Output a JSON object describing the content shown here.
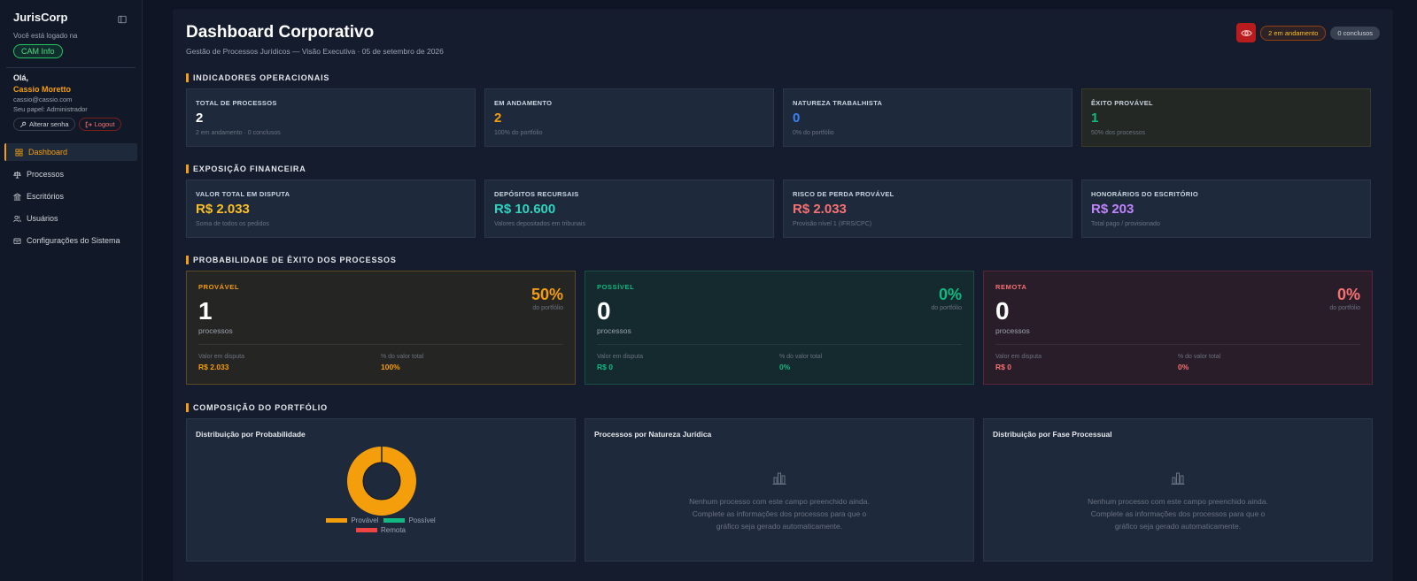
{
  "sidebar": {
    "brand": "JurisCorp",
    "logged_text": "Você está logado na",
    "company": "CAM Info",
    "greeting": "Olá,",
    "user_name": "Cassio Moretto",
    "user_email": "cassio@cassio.com",
    "user_role": "Seu papel: Administrador",
    "change_password": "Alterar senha",
    "logout": "Logout",
    "nav": [
      {
        "label": "Dashboard",
        "icon": "grid-icon",
        "active": true
      },
      {
        "label": "Processos",
        "icon": "scales-icon"
      },
      {
        "label": "Escritórios",
        "icon": "building-icon"
      },
      {
        "label": "Usuários",
        "icon": "users-icon"
      },
      {
        "label": "Configurações do Sistema",
        "icon": "gear-icon"
      }
    ]
  },
  "header": {
    "title": "Dashboard Corporativo",
    "subtitle": "Gestão de Processos Jurídicos — Visão Executiva · 05 de setembro de 2026",
    "pill_andamento": "2 em andamento",
    "pill_conclusos": "0 conclusos"
  },
  "indicadores": {
    "title": "INDICADORES OPERACIONAIS",
    "cards": [
      {
        "label": "TOTAL DE PROCESSOS",
        "value": "2",
        "sub": "2 em andamento · 0 conclusos"
      },
      {
        "label": "EM ANDAMENTO",
        "value": "2",
        "sub": "100% do portfólio"
      },
      {
        "label": "NATUREZA TRABALHISTA",
        "value": "0",
        "sub": "0% do portfólio"
      },
      {
        "label": "ÊXITO PROVÁVEL",
        "value": "1",
        "sub": "50% dos processos"
      }
    ]
  },
  "financeira": {
    "title": "EXPOSIÇÃO FINANCEIRA",
    "cards": [
      {
        "label": "VALOR TOTAL EM DISPUTA",
        "value": "R$ 2.033",
        "sub": "Soma de todos os pedidos"
      },
      {
        "label": "DEPÓSITOS RECURSAIS",
        "value": "R$ 10.600",
        "sub": "Valores depositados em tribunais"
      },
      {
        "label": "RISCO DE PERDA PROVÁVEL",
        "value": "R$ 2.033",
        "sub": "Provisão nível 1 (IFRS/CPC)"
      },
      {
        "label": "HONORÁRIOS DO ESCRITÓRIO",
        "value": "R$ 203",
        "sub": "Total pago / provisionado"
      }
    ]
  },
  "probabilidade": {
    "title": "PROBABILIDADE DE ÊXITO DOS PROCESSOS",
    "cards": [
      {
        "label": "PROVÁVEL",
        "count": "1",
        "unit": "processos",
        "pct": "50%",
        "pct_sub": "do portfólio",
        "v_label": "Valor em disputa",
        "v_value": "R$ 2.033",
        "t_label": "% do valor total",
        "t_value": "100%"
      },
      {
        "label": "POSSÍVEL",
        "count": "0",
        "unit": "processos",
        "pct": "0%",
        "pct_sub": "do portfólio",
        "v_label": "Valor em disputa",
        "v_value": "R$ 0",
        "t_label": "% do valor total",
        "t_value": "0%"
      },
      {
        "label": "REMOTA",
        "count": "0",
        "unit": "processos",
        "pct": "0%",
        "pct_sub": "do portfólio",
        "v_label": "Valor em disputa",
        "v_value": "R$ 0",
        "t_label": "% do valor total",
        "t_value": "0%"
      }
    ]
  },
  "composicao": {
    "title": "COMPOSIÇÃO DO PORTFÓLIO",
    "card1_title": "Distribuição por Probabilidade",
    "card2_title": "Processos por Natureza Jurídica",
    "card3_title": "Distribuição por Fase Processual",
    "empty_text": "Nenhum processo com este campo preenchido ainda. Complete as informações dos processos para que o gráfico seja gerado automaticamente."
  },
  "chart_data": {
    "type": "pie",
    "categories": [
      "Provável",
      "Possível",
      "Remota"
    ],
    "values": [
      1,
      0,
      0
    ],
    "colors": [
      "#f59e0b",
      "#10b981",
      "#ef4444"
    ],
    "title": "Distribuição por Probabilidade",
    "legend": "bottom"
  },
  "colors": {
    "accent": "#f59e0b",
    "background": "#0f1524",
    "card": "#1e293b"
  }
}
